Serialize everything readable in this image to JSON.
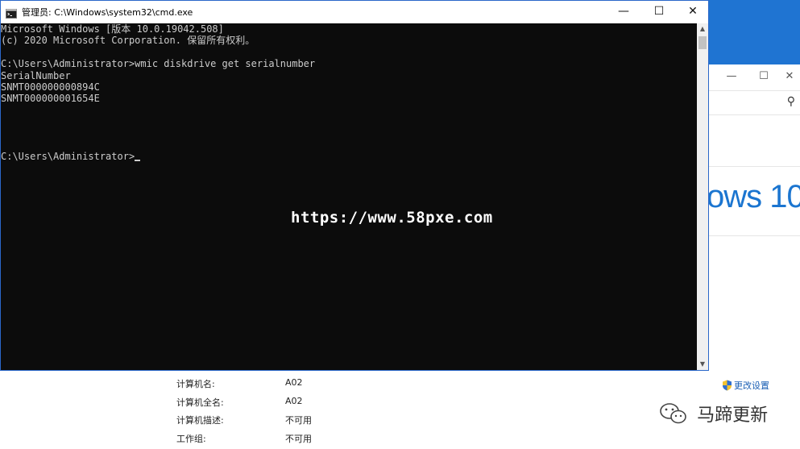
{
  "cmd": {
    "title": "管理员: C:\\Windows\\system32\\cmd.exe",
    "lines": [
      "Microsoft Windows [版本 10.0.19042.508]",
      "(c) 2020 Microsoft Corporation. 保留所有权利。",
      "",
      "C:\\Users\\Administrator>wmic diskdrive get serialnumber",
      "SerialNumber",
      "SNMT000000000894C",
      "SNMT000000001654E",
      "",
      "",
      "",
      "",
      "C:\\Users\\Administrator>"
    ],
    "controls": {
      "minimize": "—",
      "maximize": "☐",
      "close": "✕"
    }
  },
  "background": {
    "controls": {
      "minimize": "—",
      "maximize": "☐",
      "close": "✕"
    },
    "search_icon": "search-icon",
    "windows_logo_text": "ows 10",
    "info": [
      {
        "label": "计算机名:",
        "value": "A02"
      },
      {
        "label": "计算机全名:",
        "value": "A02"
      },
      {
        "label": "计算机描述:",
        "value": "不可用"
      },
      {
        "label": "工作组:",
        "value": "不可用"
      }
    ],
    "change_settings": "更改设置"
  },
  "watermark": "https://www.58pxe.com",
  "wechat_account": "马蹄更新",
  "colors": {
    "console_bg": "#0c0c0c",
    "console_text": "#cccccc",
    "accent_blue": "#1f74d2",
    "link": "#1a5fb4"
  }
}
